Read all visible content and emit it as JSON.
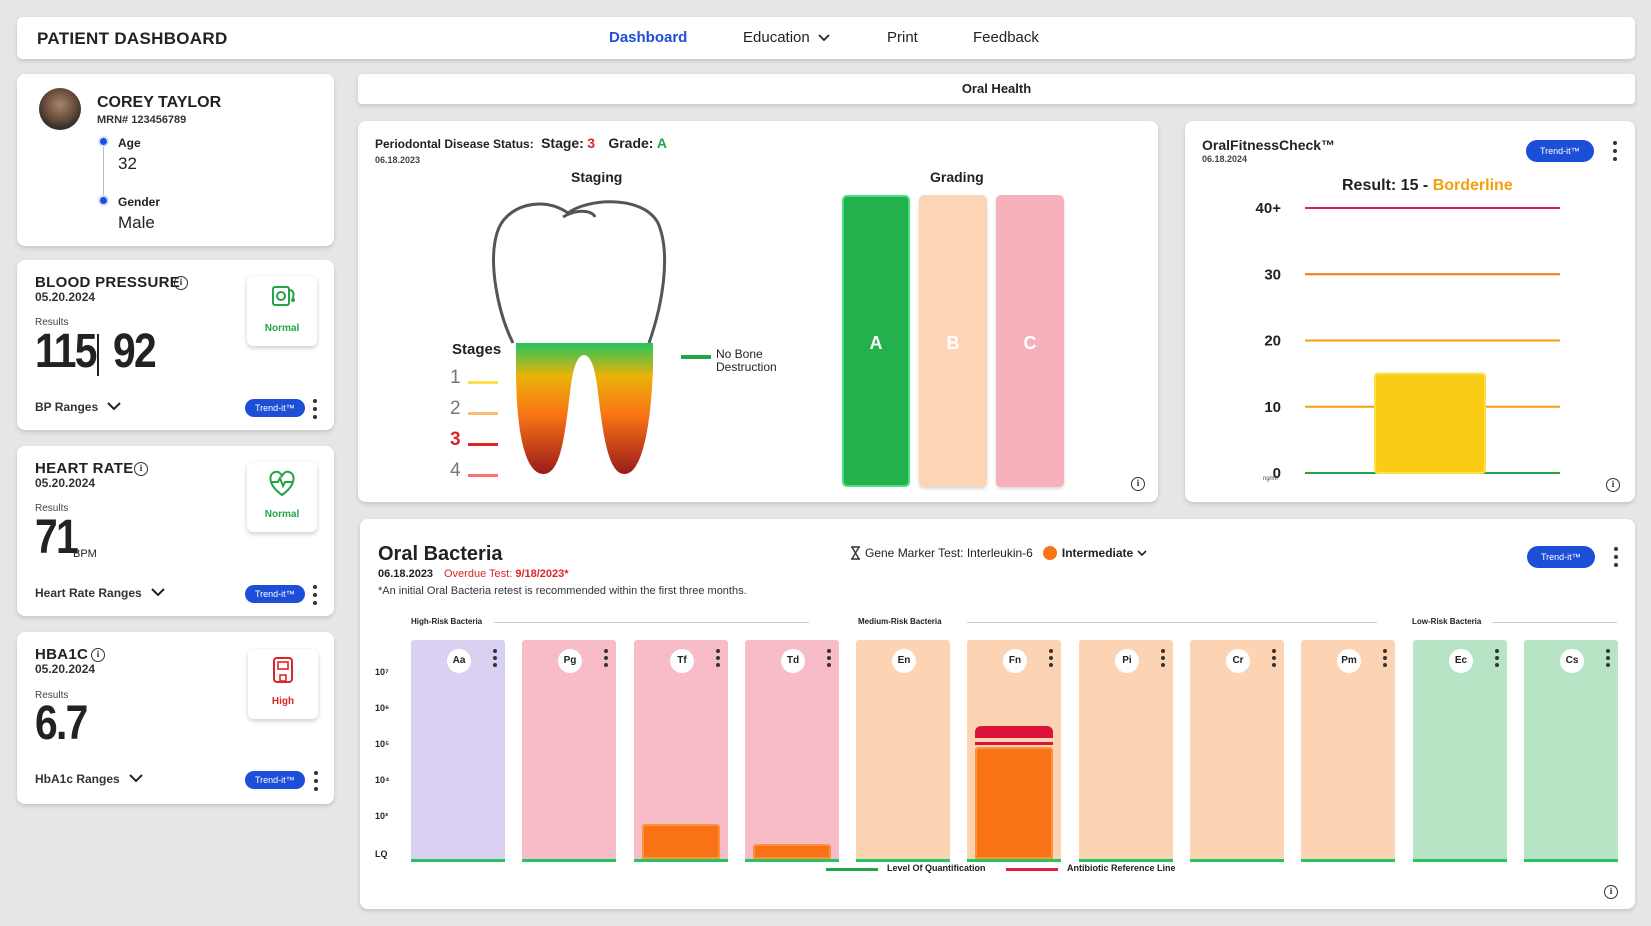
{
  "header": {
    "brand": "PATIENT DASHBOARD",
    "nav": {
      "dashboard": "Dashboard",
      "education": "Education",
      "print": "Print",
      "feedback": "Feedback"
    }
  },
  "patient": {
    "name": "COREY TAYLOR",
    "mrn": "MRN# 123456789",
    "age_label": "Age",
    "age": "32",
    "gender_label": "Gender",
    "gender": "Male"
  },
  "vitals": {
    "bp": {
      "title": "BLOOD PRESSURE",
      "date": "05.20.2024",
      "results_label": "Results",
      "systolic": "115",
      "diastolic": "92",
      "status": "Normal",
      "ranges": "BP Ranges",
      "trend": "Trend-it™"
    },
    "hr": {
      "title": "HEART RATE",
      "date": "05.20.2024",
      "results_label": "Results",
      "value": "71",
      "unit": "BPM",
      "status": "Normal",
      "ranges": "Heart Rate Ranges",
      "trend": "Trend-it™"
    },
    "hba1c": {
      "title": "HBA1C",
      "date": "05.20.2024",
      "results_label": "Results",
      "value": "6.7",
      "status": "High",
      "ranges": "HbA1c Ranges",
      "trend": "Trend-it™"
    }
  },
  "oral_health": {
    "header": "Oral Health",
    "perio": {
      "status_label": "Periodontal Disease Status:",
      "stage_label": "Stage:",
      "stage": "3",
      "grade_label": "Grade:",
      "grade": "A",
      "date": "06.18.2023",
      "staging_title": "Staging",
      "grading_title": "Grading",
      "stages_title": "Stages",
      "stage_nums": [
        "1",
        "2",
        "3",
        "4"
      ],
      "no_bone_1": "No Bone",
      "no_bone_2": "Destruction",
      "grades": [
        "A",
        "B",
        "C"
      ]
    },
    "fitness": {
      "title": "OralFitnessCheck™",
      "date": "06.18.2024",
      "trend": "Trend-it™",
      "result_label": "Result: 15 -",
      "result_status": "Borderline",
      "unit": "ng/ml"
    }
  },
  "chart_data": {
    "type": "bar",
    "title": "Result: 15 - Borderline",
    "yticks": [
      "0",
      "10",
      "20",
      "30",
      "40+"
    ],
    "ylim": [
      0,
      40
    ],
    "values": [
      15
    ],
    "reference_lines": [
      10,
      20,
      30,
      40
    ]
  },
  "bacteria": {
    "title": "Oral Bacteria",
    "date": "06.18.2023",
    "overdue_label": "Overdue Test:",
    "overdue_date": "9/18/2023*",
    "note": "*An initial Oral Bacteria retest is recommended within the first three months.",
    "gene_label": "Gene Marker Test: Interleukin-6",
    "gene_status": "Intermediate",
    "trend": "Trend-it™",
    "groups": {
      "high": "High-Risk Bacteria",
      "medium": "Medium-Risk Bacteria",
      "low": "Low-Risk Bacteria"
    },
    "yticks": [
      "10⁷",
      "10⁶",
      "10⁵",
      "10⁴",
      "10³",
      "LQ"
    ],
    "items": [
      "Aa",
      "Pg",
      "Tf",
      "Td",
      "En",
      "Fn",
      "Pi",
      "Cr",
      "Pm",
      "Ec",
      "Cs"
    ],
    "legend_lq": "Level Of Quantification",
    "legend_abx": "Antibiotic Reference Line"
  }
}
